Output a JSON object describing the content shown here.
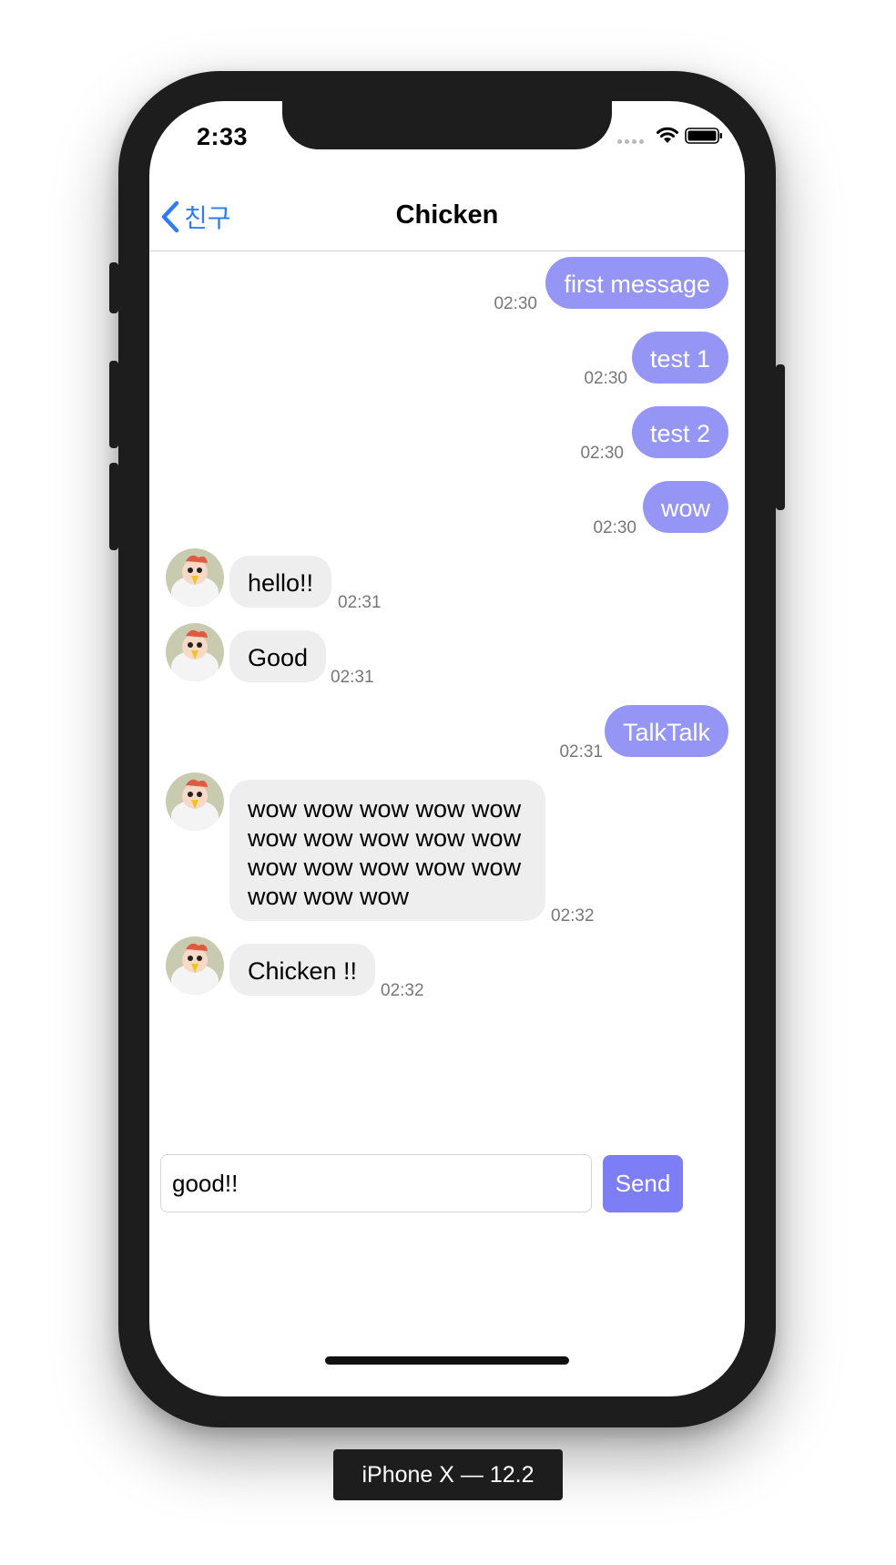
{
  "status_bar": {
    "time": "2:33"
  },
  "nav": {
    "back_label": "친구",
    "title": "Chicken"
  },
  "messages": [
    {
      "text": "first message",
      "time": "02:30",
      "sender": "me"
    },
    {
      "text": "test 1",
      "time": "02:30",
      "sender": "me"
    },
    {
      "text": "test 2",
      "time": "02:30",
      "sender": "me"
    },
    {
      "text": "wow",
      "time": "02:30",
      "sender": "me"
    },
    {
      "text": "hello!!",
      "time": "02:31",
      "sender": "friend"
    },
    {
      "text": "Good",
      "time": "02:31",
      "sender": "friend"
    },
    {
      "text": "TalkTalk",
      "time": "02:31",
      "sender": "me"
    },
    {
      "text": "wow wow wow wow wow wow wow wow wow wow wow wow wow wow wow wow wow wow",
      "time": "02:32",
      "sender": "friend"
    },
    {
      "text": "Chicken !!",
      "time": "02:32",
      "sender": "friend"
    }
  ],
  "composer": {
    "value": "good!!",
    "send_label": "Send"
  },
  "device_label": "iPhone X — 12.2",
  "colors": {
    "outgoing_bubble": "#9595f6",
    "incoming_bubble": "#eeeeee",
    "send_button": "#7d7df5",
    "back_link": "#2f7cf6"
  }
}
